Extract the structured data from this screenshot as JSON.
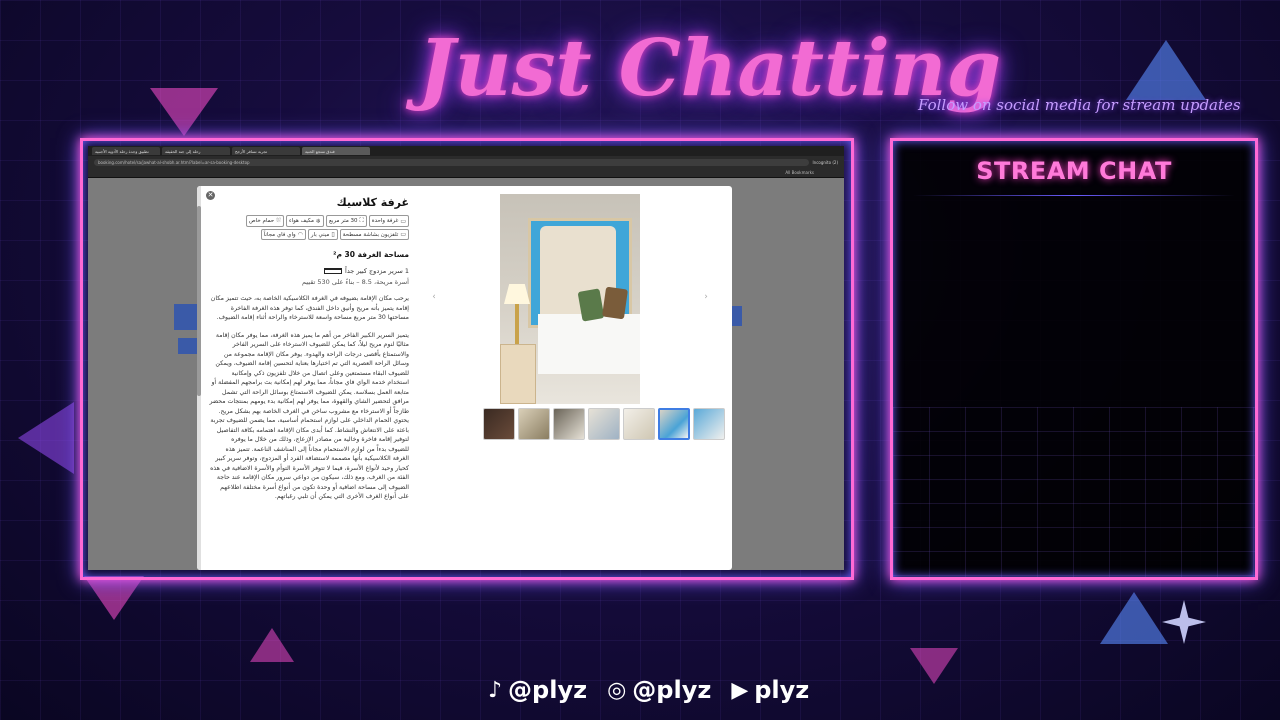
{
  "overlay": {
    "title": "Just Chatting",
    "subtitle": "Follow on social media for stream updates",
    "chat_title": "STREAM CHAT",
    "socials": [
      {
        "icon": "tiktok-icon",
        "handle": "@plyz"
      },
      {
        "icon": "instagram-icon",
        "handle": "@plyz"
      },
      {
        "icon": "youtube-icon",
        "handle": "plyz"
      }
    ],
    "colors": {
      "neon_pink": "#ff6ad5",
      "neon_blue": "#6a5cff",
      "background": "#160c3d"
    }
  },
  "browser": {
    "tabs": [
      "تطبيق وجدة رحلة الأدوية الأجنبية",
      "رحلة إلى جنة الحقيقة",
      "تجربة تسافر الأرجح",
      "فندق منتجع الحنية"
    ],
    "url": "booking.com/hotel/sa/jawhat-al-shobh.ar.html?label=ar-sa-booking-desktop",
    "incognito_label": "Incognito (2)",
    "bookmarks_label": "All Bookmarks"
  },
  "modal": {
    "close_icon": "close-icon",
    "room_title": "غرفة كلاسيك",
    "chips": [
      {
        "icon": "bed-icon",
        "label": "غرفة واحدة"
      },
      {
        "icon": "area-icon",
        "label": "30 متر مربع"
      },
      {
        "icon": "snowflake-icon",
        "label": "مكيف هواء"
      },
      {
        "icon": "bath-icon",
        "label": "حمام خاص"
      },
      {
        "icon": "tv-icon",
        "label": "تلفزيون بشاشة مسطحة"
      },
      {
        "icon": "minibar-icon",
        "label": "ميني بار"
      },
      {
        "icon": "wifi-icon",
        "label": "واي فاي مجاناً"
      }
    ],
    "room_size": "مساحة الغرفة 30 م²",
    "bed": "1 سرير مزدوج كبير جداً",
    "rating": "أسرة مريحة، 8.5 – بناءً على 530 تقييم",
    "paragraphs": [
      "يرحب مكان الإقامة بضيوفه في الغرفة الكلاسيكية الخاصة به، حيث تتميز مكان إقامة يتميز بأنه مريح وأنيق داخل الفندق، كما توفر هذه الغرفة الفاخرة مساحتها 30 متر مربع مساحة واسعة للاسترخاء والراحة أثناء إقامة الضيوف.",
      "يتميز السرير الكبير الفاخر من أهم ما يميز هذه الغرفة، مما يوفر مكان إقامة مثاليًا لنوم مريح ليلاً، كما يمكن للضيوف الاسترخاء على السرير الفاخر والاستمتاع بأقصى درجات الراحة والهدوء. يوفر مكان الإقامة مجموعة من وسائل الراحة العصرية التي تم اختيارها بعناية لتحسين إقامة الضيوف، ويمكن للضيوف البقاء مستمتعين وعلى اتصال من خلال تلفزيون ذكي وإمكانية استخدام خدمة الواي فاي مجاناً، مما يوفر لهم إمكانية بث برامجهم المفضلة أو متابعة العمل بسلاسة. يمكن للضيوف الاستمتاع بوسائل الراحة التي تشمل مرافق لتحضير الشاي والقهوة، مما يوفر لهم إمكانية بدء يومهم بمنتجات محضر طازجاً أو الاسترخاء مع مشروب ساخن في الغرف الخاصة بهم بشكل مريح. يحتوي الحمام الداخلي على لوازم استحمام أساسية، مما يضمن للضيوف تجربة باعثة على الانتعاش والنشاط. كما أبدى مكان الإقامة اهتمامه بكافة التفاصيل لتوفير إقامة فاخرة وخالية من مصادر الإزعاج، وذلك من خلال ما يوفره للضيوف بدءاً من لوازم الاستحمام مجاناً إلى المناشف الناعمة. تتميز هذه الغرفة الكلاسيكية بأنها مصممة لاستضافة الفرد أو المزدوج، وتوفر سرير كبير كحيار وحيد لأنواع الأسرة، فيما لا تتوفر الأسرة التوأم والأسرة الاضافية في هذه الفئة من الغرف، ومع ذلك، سيكون من دواعي سرور مكان الإقامة عند حاجة الضيوف إلى مساحة اضافية أو وحدة تكون من أنواع أسرة مختلفة اطلاعهم على أنواع الغرف الأخرى التي يمكن أن تلبي رغباتهم."
    ],
    "gallery": {
      "prev_icon": "chevron-left-icon",
      "next_icon": "chevron-right-icon",
      "thumb_count": 7,
      "selected_thumb": 6
    }
  }
}
